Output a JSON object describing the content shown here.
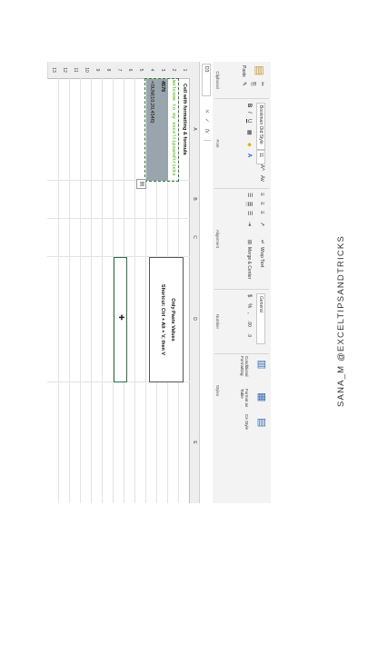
{
  "ribbon": {
    "clipboard": {
      "paste": "Paste",
      "label": "Clipboard"
    },
    "font": {
      "name": "Bookman Old Style",
      "size": "11",
      "label": "Font",
      "bold": "B",
      "italic": "I",
      "underline": "U",
      "grow": "A^",
      "shrink": "Av"
    },
    "alignment": {
      "wrap_text": "Wrap Text",
      "merge_center": "Merge & Center",
      "label": "Alignment"
    },
    "number": {
      "format": "General",
      "currency": "$",
      "percent": "%",
      "comma": ",",
      "inc_dec": ".00",
      "dec_dec": ".0",
      "label": "Number"
    },
    "styles": {
      "conditional": "Conditional Formatting",
      "format_table": "Format as Table",
      "cell_styles": "Ce Style",
      "label": "Styles"
    }
  },
  "formula_bar": {
    "name_box": "D3",
    "fx": "fx",
    "cancel": "✕",
    "enter": "✓"
  },
  "columns": [
    "A",
    "B",
    "C",
    "D",
    "E"
  ],
  "rows": [
    "1",
    "2",
    "3",
    "4",
    "5",
    "6",
    "7",
    "8",
    "9",
    "10",
    "11",
    "12",
    "13"
  ],
  "cells": {
    "a1": "Cell with formatting & formula",
    "a2": "Welcome to my exceltipsandtricks",
    "a3": "4576",
    "a4": "=SUM(10,20,4546)"
  },
  "note": {
    "line1": "Only Paste Values",
    "line2": "Shortcut: Ctrl + Alt + V, then V"
  },
  "paste_options_icon": "paste-options-icon",
  "watermark": "SANA_M @EXCELTIPSANDTRICKS",
  "colors": {
    "selection_fill": "#9aa4ac",
    "copy_border": "#2e7d32",
    "green_text": "#7cc24a",
    "ribbon_bg": "#f3f3f3"
  }
}
